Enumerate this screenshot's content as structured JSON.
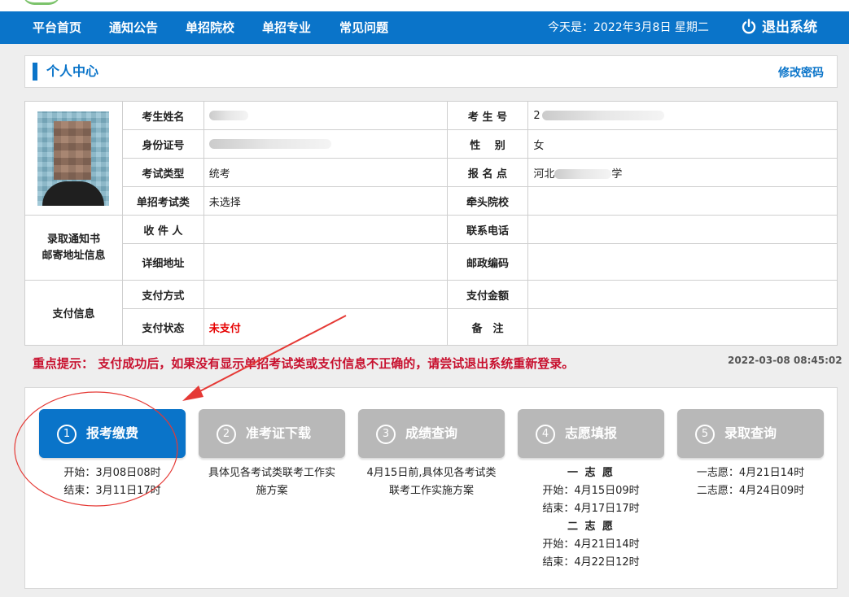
{
  "nav": {
    "items": [
      "平台首页",
      "通知公告",
      "单招院校",
      "单招专业",
      "常见问题"
    ],
    "date": "今天是：2022年3月8日 星期二",
    "logout": "退出系统"
  },
  "panel": {
    "title": "个人中心",
    "change_password": "修改密码"
  },
  "info": {
    "name_label": "考生姓名",
    "exam_no_label": "考 生 号",
    "id_label": "身份证号",
    "gender_label": "性　 别",
    "gender_value": "女",
    "exam_type_label": "考试类型",
    "exam_type_value": "统考",
    "site_label": "报 名 点",
    "site_value_prefix": "河北",
    "site_value_suffix": "学",
    "single_exam_label": "单招考试类",
    "single_exam_value": "未选择",
    "lead_school_label": "牵头院校",
    "mail_section_label": "录取通知书 邮寄地址信息",
    "recipient_label": "收 件 人",
    "phone_label": "联系电话",
    "address_label": "详细地址",
    "postcode_label": "邮政编码",
    "pay_section_label": "支付信息",
    "pay_method_label": "支付方式",
    "pay_amount_label": "支付金额",
    "pay_status_label": "支付状态",
    "pay_status_value": "未支付",
    "remark_label": "备　注",
    "exam_no_visible": "2"
  },
  "notice": {
    "key": "重点提示：",
    "text": "支付成功后，如果没有显示单招考试类或支付信息不正确的，请尝试退出系统重新登录。",
    "timestamp": "2022-03-08 08:45:02"
  },
  "steps": [
    {
      "num": "1",
      "name": "报考缴费",
      "active": true,
      "lines": [
        "开始：3月08日08时",
        "结束：3月11日17时"
      ]
    },
    {
      "num": "2",
      "name": "准考证下载",
      "active": false,
      "lines": [
        "具体见各考试类联考工作实",
        "施方案"
      ]
    },
    {
      "num": "3",
      "name": "成绩查询",
      "active": false,
      "lines": [
        "4月15日前,具体见各考试类",
        "联考工作实施方案"
      ]
    },
    {
      "num": "4",
      "name": "志愿填报",
      "active": false,
      "lines": [
        "一 志 愿",
        "开始：4月15日09时",
        "结束：4月17日17时",
        "二 志 愿",
        "开始：4月21日14时",
        "结束：4月22日12时"
      ]
    },
    {
      "num": "5",
      "name": "录取查询",
      "active": false,
      "lines": [
        "一志愿：4月21日14时",
        "二志愿：4月24日09时"
      ]
    }
  ],
  "colors": {
    "primary": "#0a74c9",
    "inactive_step": "#b8b8b8",
    "notice_red": "#c8102e",
    "annotation_red": "#e53935"
  }
}
